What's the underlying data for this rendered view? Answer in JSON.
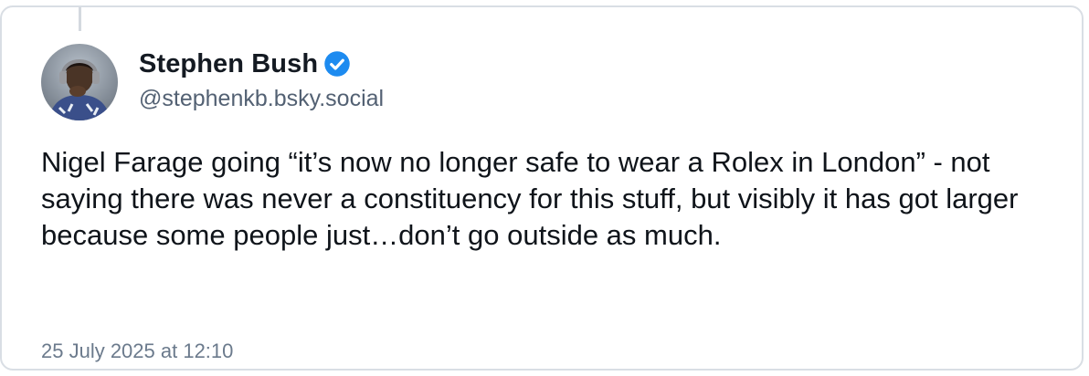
{
  "post": {
    "author": {
      "display_name": "Stephen Bush",
      "handle": "@stephenkb.bsky.social",
      "verified": true,
      "avatar_icon": "user-avatar"
    },
    "text": "Nigel Farage going “it’s now no longer safe to wear a Rolex in London” - not saying there was never a constituency for this stuff, but visibly it has got larger because some people just…don’t go outside as much.",
    "timestamp": "25 July 2025 at 12:10"
  },
  "colors": {
    "verified_badge": "#1d8bf0",
    "handle": "#536173",
    "timestamp": "#6b7a8c",
    "border": "#d9dee4"
  }
}
